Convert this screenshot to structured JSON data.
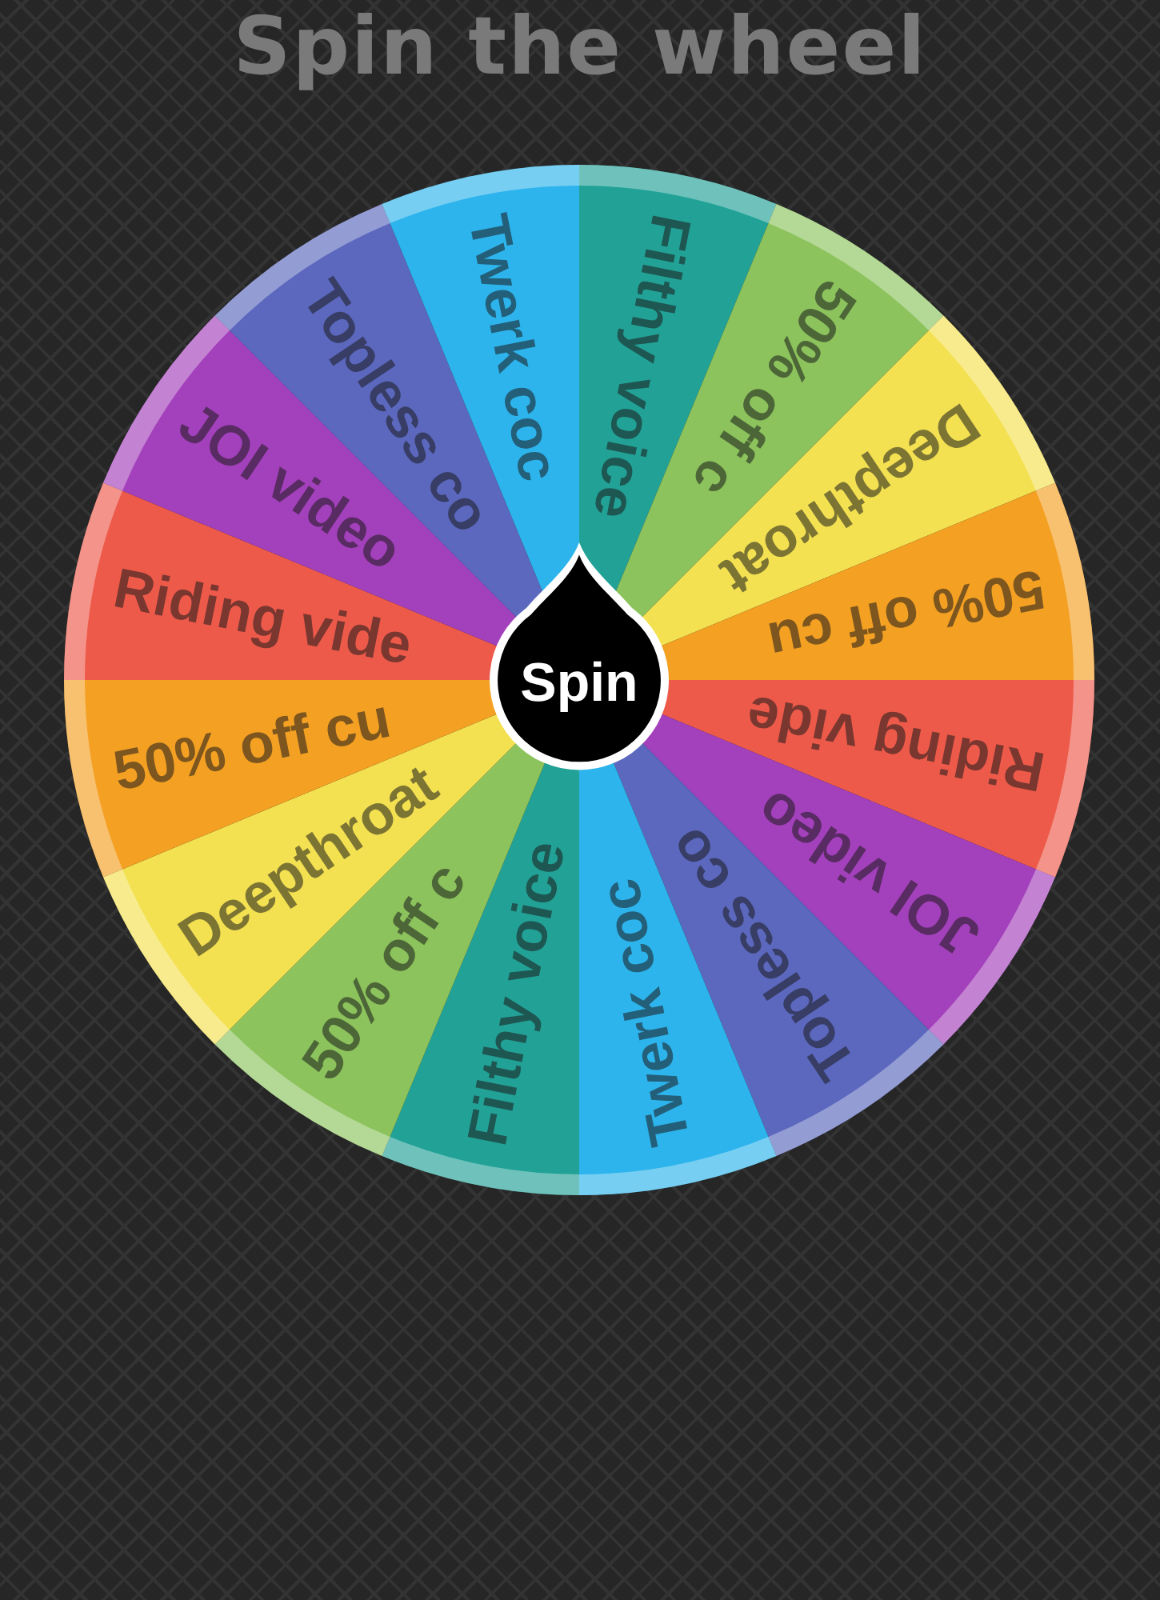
{
  "title": "Spin the wheel",
  "wheel": {
    "segments": [
      {
        "label": "Filthy voice",
        "color": "#22a297"
      },
      {
        "label": "50% off c",
        "color": "#8cc35c"
      },
      {
        "label": "Deepthroat",
        "color": "#f3e151"
      },
      {
        "label": "50% off cu",
        "color": "#f4a023"
      },
      {
        "label": "Riding vide",
        "color": "#ee5a4a"
      },
      {
        "label": "JOI video",
        "color": "#a340bb"
      },
      {
        "label": "Topless co",
        "color": "#5b68be"
      },
      {
        "label": "Twerk coc",
        "color": "#2db4ec"
      },
      {
        "label": "Filthy voice",
        "color": "#22a297"
      },
      {
        "label": "50% off c",
        "color": "#8cc35c"
      },
      {
        "label": "Deepthroat",
        "color": "#f3e151"
      },
      {
        "label": "50% off cu",
        "color": "#f4a023"
      },
      {
        "label": "Riding vide",
        "color": "#ee5a4a"
      },
      {
        "label": "JOI video",
        "color": "#a340bb"
      },
      {
        "label": "Topless co",
        "color": "#5b68be"
      },
      {
        "label": "Twerk coc",
        "color": "#2db4ec"
      }
    ]
  },
  "spin_button": {
    "label": "Spin"
  }
}
